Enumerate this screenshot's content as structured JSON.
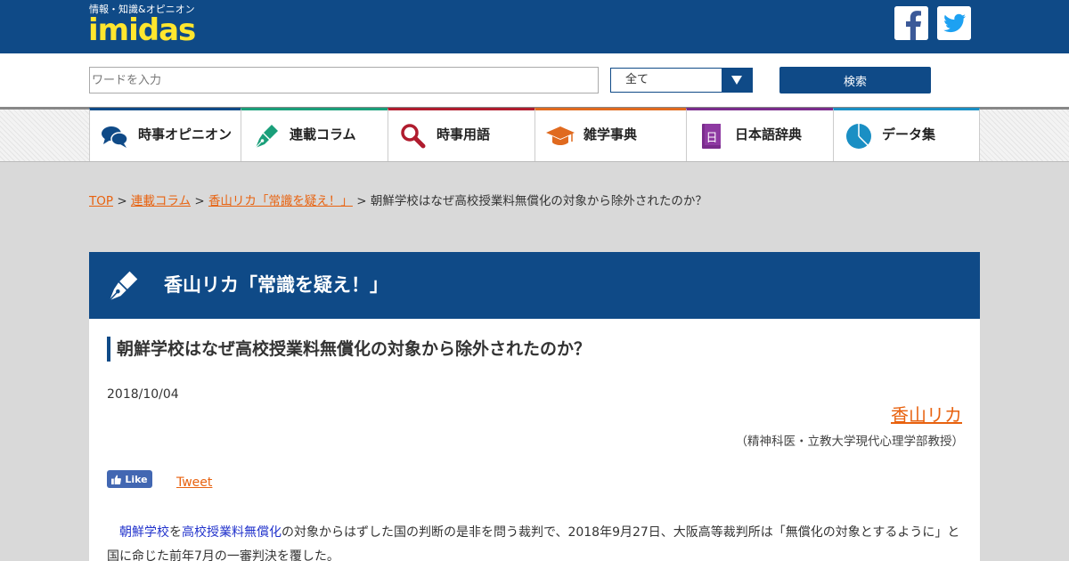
{
  "header": {
    "tagline": "情報・知識&オピニオン",
    "logo": "imidas",
    "social": [
      {
        "name": "facebook-icon",
        "glyph": "f"
      },
      {
        "name": "twitter-icon"
      }
    ]
  },
  "search": {
    "placeholder": "ワードを入力",
    "category_selected": "全て",
    "button_label": "検索"
  },
  "nav": {
    "items": [
      {
        "label": "時事オピニオン",
        "color": "#0f4a87",
        "icon": "speech-bubbles-icon"
      },
      {
        "label": "連載コラム",
        "color": "#1a9f7a",
        "icon": "pen-nib-icon"
      },
      {
        "label": "時事用語",
        "color": "#b01c2e",
        "icon": "magnifier-icon"
      },
      {
        "label": "雑学事典",
        "color": "#e06a1f",
        "icon": "mortarboard-icon"
      },
      {
        "label": "日本語辞典",
        "color": "#7a2c8c",
        "icon": "dictionary-icon"
      },
      {
        "label": "データ集",
        "color": "#1a8fc4",
        "icon": "pie-chart-icon"
      }
    ]
  },
  "breadcrumb": {
    "items": [
      "TOP",
      "連載コラム",
      "香山リカ「常識を疑え！」"
    ],
    "separator": ">",
    "current": "朝鮮学校はなぜ高校授業料無償化の対象から除外されたのか？"
  },
  "column": {
    "title": "香山リカ「常識を疑え！」"
  },
  "article": {
    "title": "朝鮮学校はなぜ高校授業料無償化の対象から除外されたのか？",
    "date": "2018/10/04",
    "author": "香山リカ",
    "affiliation": "（精神科医・立教大学現代心理学部教授）",
    "like_label": "Like",
    "tweet_label": "Tweet",
    "link1": "朝鮮学校",
    "join": "を",
    "link2": "高校授業料無償化",
    "body_rest": "の対象からはずした国の判断の是非を問う裁判で、2018年9月27日、大阪高等裁判所は「無償化の対象とするように」と国に命じた前年7月の一審判決を覆した。"
  }
}
